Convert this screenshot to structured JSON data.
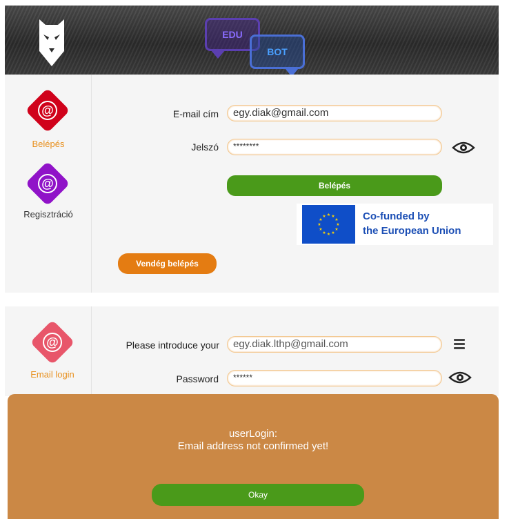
{
  "header": {
    "logo_text_1": "EDU",
    "logo_text_2": "BOT"
  },
  "login_panel": {
    "sidebar": {
      "login_label": "Belépés",
      "register_label": "Regisztráció"
    },
    "email_label": "E-mail cím",
    "email_value": "egy.diak@gmail.com",
    "password_label": "Jelszó",
    "password_value": "********",
    "login_button": "Belépés",
    "guest_button": "Vendég belépés",
    "eu_line1": "Co-funded by",
    "eu_line2": "the European Union"
  },
  "email_panel": {
    "sidebar_label": "Email login",
    "email_label": "Please introduce your",
    "email_value": "egy.diak.lthp@gmail.com",
    "password_label": "Password",
    "password_value": "******"
  },
  "modal": {
    "line1": "userLogin:",
    "line2": "Email address not confirmed yet!",
    "ok_button": "Okay"
  },
  "colors": {
    "accent_orange": "#e47c12",
    "green": "#4a9a1a",
    "red_diamond": "#d0021b",
    "purple_diamond": "#9013c8",
    "pink_diamond": "#e8566a",
    "modal_bg": "#cb8845"
  }
}
